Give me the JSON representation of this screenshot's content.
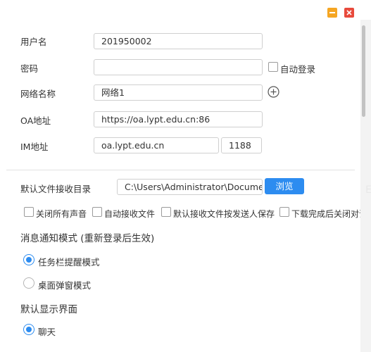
{
  "window": {
    "minimize_icon": "minimize-icon",
    "close_icon": "close-icon"
  },
  "form": {
    "username_label": "用户名",
    "username_value": "201950002",
    "password_label": "密码",
    "password_value": "",
    "auto_login_label": "自动登录",
    "network_label": "网络名称",
    "network_value": "网络1",
    "add_network_icon": "plus-circle-icon",
    "oa_label": "OA地址",
    "oa_value": "https://oa.lypt.edu.cn:86",
    "im_label": "IM地址",
    "im_host_value": "oa.lypt.edu.cn",
    "im_port_value": "1188"
  },
  "files": {
    "dir_label": "默认文件接收目录",
    "dir_value": "C:\\Users\\Administrator\\Docume",
    "browse_label": "浏览"
  },
  "options": [
    {
      "label": "关闭所有声音",
      "checked": false
    },
    {
      "label": "自动接收文件",
      "checked": false
    },
    {
      "label": "默认接收文件按发送人保存",
      "checked": false
    },
    {
      "label": "下载完成后关闭对话",
      "checked": false
    }
  ],
  "notify": {
    "title": "消息通知模式 (重新登录后生效)",
    "taskbar_label": "任务栏提醒模式",
    "popup_label": "桌面弹窗模式",
    "selected": "任务栏提醒模式"
  },
  "default_view": {
    "title": "默认显示界面",
    "chat_label": "聊天",
    "selected": "聊天"
  },
  "colors": {
    "accent": "#2d8cf0",
    "minimize": "#f5a623",
    "close": "#e84a3c"
  }
}
